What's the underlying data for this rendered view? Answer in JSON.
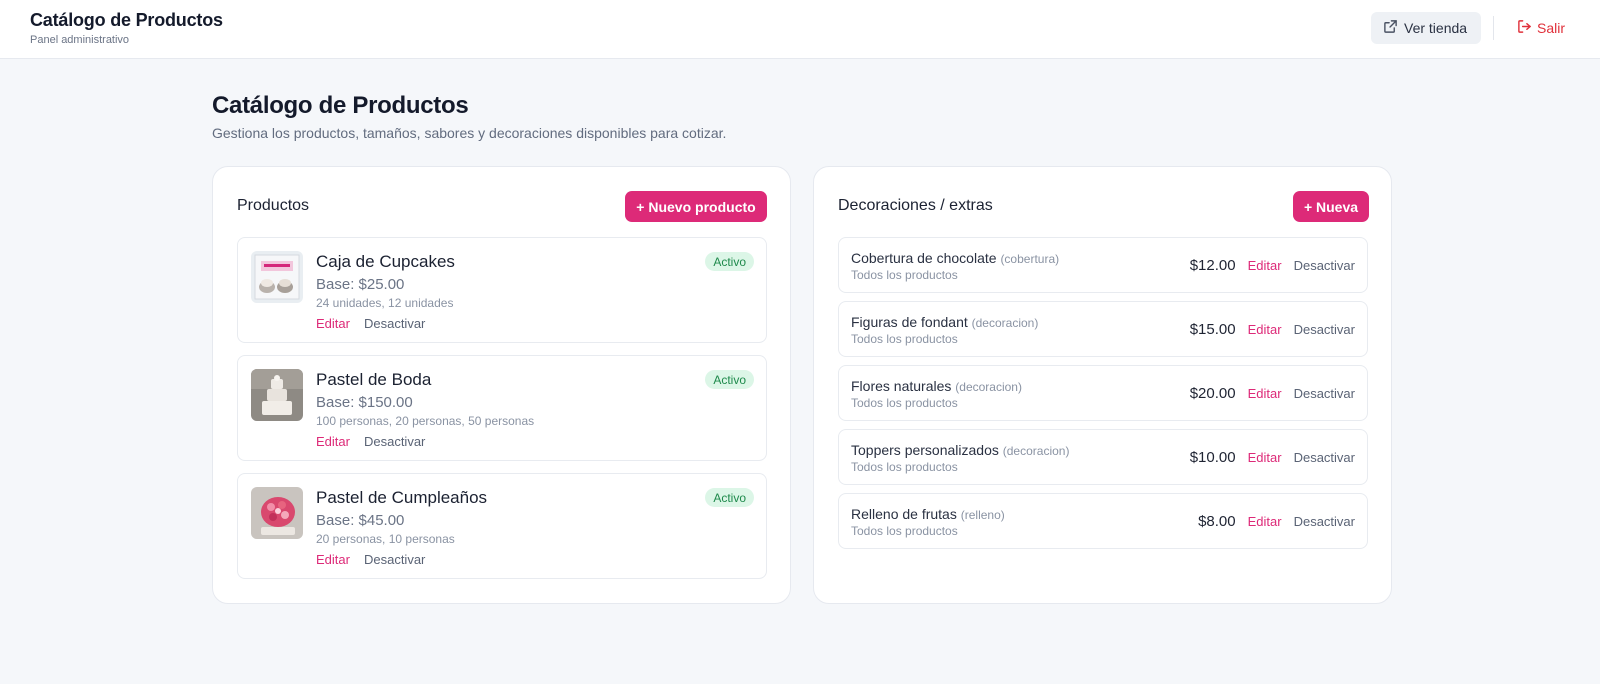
{
  "header": {
    "title": "Catálogo de Productos",
    "subtitle": "Panel administrativo",
    "store_button": "Ver tienda",
    "exit_button": "Salir"
  },
  "page": {
    "title": "Catálogo de Productos",
    "subtitle": "Gestiona los productos, tamaños, sabores y decoraciones disponibles para cotizar."
  },
  "products": {
    "title": "Productos",
    "new_button": "+ Nuevo producto",
    "items": [
      {
        "name": "Caja de Cupcakes",
        "base": "Base: $25.00",
        "sizes": "24 unidades, 12 unidades",
        "status": "Activo",
        "edit": "Editar",
        "deactivate": "Desactivar"
      },
      {
        "name": "Pastel de Boda",
        "base": "Base: $150.00",
        "sizes": "100 personas, 20 personas, 50 personas",
        "status": "Activo",
        "edit": "Editar",
        "deactivate": "Desactivar"
      },
      {
        "name": "Pastel de Cumpleaños",
        "base": "Base: $45.00",
        "sizes": "20 personas, 10 personas",
        "status": "Activo",
        "edit": "Editar",
        "deactivate": "Desactivar"
      }
    ]
  },
  "decorations": {
    "title": "Decoraciones / extras",
    "new_button": "+ Nueva",
    "items": [
      {
        "name": "Cobertura de chocolate",
        "type": "(cobertura)",
        "scope": "Todos los productos",
        "price": "$12.00",
        "edit": "Editar",
        "deactivate": "Desactivar"
      },
      {
        "name": "Figuras de fondant",
        "type": "(decoracion)",
        "scope": "Todos los productos",
        "price": "$15.00",
        "edit": "Editar",
        "deactivate": "Desactivar"
      },
      {
        "name": "Flores naturales",
        "type": "(decoracion)",
        "scope": "Todos los productos",
        "price": "$20.00",
        "edit": "Editar",
        "deactivate": "Desactivar"
      },
      {
        "name": "Toppers personalizados",
        "type": "(decoracion)",
        "scope": "Todos los productos",
        "price": "$10.00",
        "edit": "Editar",
        "deactivate": "Desactivar"
      },
      {
        "name": "Relleno de frutas",
        "type": "(relleno)",
        "scope": "Todos los productos",
        "price": "$8.00",
        "edit": "Editar",
        "deactivate": "Desactivar"
      }
    ]
  },
  "colors": {
    "accent": "#dd2a78",
    "danger": "#e0303a",
    "success_bg": "#dcf6e7",
    "success_text": "#1f8a4c"
  },
  "icons": {
    "store": "external-link-icon",
    "exit": "logout-icon"
  }
}
